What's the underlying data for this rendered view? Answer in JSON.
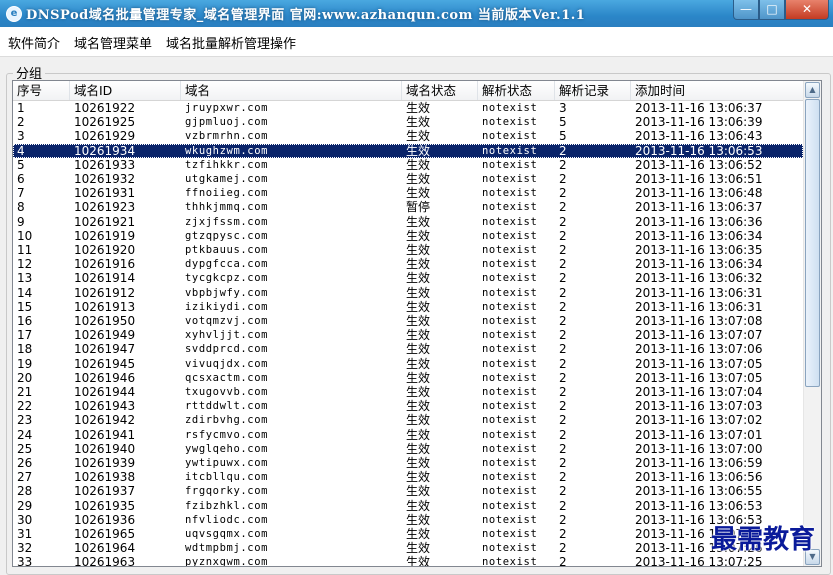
{
  "window": {
    "title": "DNSPod域名批量管理专家_域名管理界面 官网:www.azhanqun.com 当前版本Ver.1.1",
    "minimize": "—",
    "maximize": "□",
    "close": "✕"
  },
  "menu": [
    "软件简介",
    "域名管理菜单",
    "域名批量解析管理操作"
  ],
  "group_label": "分组",
  "columns": [
    "序号",
    "域名ID",
    "域名",
    "域名状态",
    "解析状态",
    "解析记录",
    "添加时间"
  ],
  "selected_row": 4,
  "rows": [
    [
      "1",
      "10261922",
      "jruypxwr.com",
      "生效",
      "notexist",
      "3",
      "2013-11-16 13:06:37"
    ],
    [
      "2",
      "10261925",
      "gjpmluoj.com",
      "生效",
      "notexist",
      "5",
      "2013-11-16 13:06:39"
    ],
    [
      "3",
      "10261929",
      "vzbrmrhn.com",
      "生效",
      "notexist",
      "5",
      "2013-11-16 13:06:43"
    ],
    [
      "4",
      "10261934",
      "wkughzwm.com",
      "生效",
      "notexist",
      "2",
      "2013-11-16 13:06:53"
    ],
    [
      "5",
      "10261933",
      "tzfihkkr.com",
      "生效",
      "notexist",
      "2",
      "2013-11-16 13:06:52"
    ],
    [
      "6",
      "10261932",
      "utgkamej.com",
      "生效",
      "notexist",
      "2",
      "2013-11-16 13:06:51"
    ],
    [
      "7",
      "10261931",
      "ffnoiieg.com",
      "生效",
      "notexist",
      "2",
      "2013-11-16 13:06:48"
    ],
    [
      "8",
      "10261923",
      "thhkjmmq.com",
      "暂停",
      "notexist",
      "2",
      "2013-11-16 13:06:37"
    ],
    [
      "9",
      "10261921",
      "zjxjfssm.com",
      "生效",
      "notexist",
      "2",
      "2013-11-16 13:06:36"
    ],
    [
      "10",
      "10261919",
      "gtzqpysc.com",
      "生效",
      "notexist",
      "2",
      "2013-11-16 13:06:34"
    ],
    [
      "11",
      "10261920",
      "ptkbauus.com",
      "生效",
      "notexist",
      "2",
      "2013-11-16 13:06:35"
    ],
    [
      "12",
      "10261916",
      "dypgfcca.com",
      "生效",
      "notexist",
      "2",
      "2013-11-16 13:06:34"
    ],
    [
      "13",
      "10261914",
      "tycgkcpz.com",
      "生效",
      "notexist",
      "2",
      "2013-11-16 13:06:32"
    ],
    [
      "14",
      "10261912",
      "vbpbjwfy.com",
      "生效",
      "notexist",
      "2",
      "2013-11-16 13:06:31"
    ],
    [
      "15",
      "10261913",
      "izikiydi.com",
      "生效",
      "notexist",
      "2",
      "2013-11-16 13:06:31"
    ],
    [
      "16",
      "10261950",
      "votqmzvj.com",
      "生效",
      "notexist",
      "2",
      "2013-11-16 13:07:08"
    ],
    [
      "17",
      "10261949",
      "xyhvljjt.com",
      "生效",
      "notexist",
      "2",
      "2013-11-16 13:07:07"
    ],
    [
      "18",
      "10261947",
      "svddprcd.com",
      "生效",
      "notexist",
      "2",
      "2013-11-16 13:07:06"
    ],
    [
      "19",
      "10261945",
      "vivuqjdx.com",
      "生效",
      "notexist",
      "2",
      "2013-11-16 13:07:05"
    ],
    [
      "20",
      "10261946",
      "qcsxactm.com",
      "生效",
      "notexist",
      "2",
      "2013-11-16 13:07:05"
    ],
    [
      "21",
      "10261944",
      "txugovvb.com",
      "生效",
      "notexist",
      "2",
      "2013-11-16 13:07:04"
    ],
    [
      "22",
      "10261943",
      "rttddwlt.com",
      "生效",
      "notexist",
      "2",
      "2013-11-16 13:07:03"
    ],
    [
      "23",
      "10261942",
      "zdirbvhg.com",
      "生效",
      "notexist",
      "2",
      "2013-11-16 13:07:02"
    ],
    [
      "24",
      "10261941",
      "rsfycmvo.com",
      "生效",
      "notexist",
      "2",
      "2013-11-16 13:07:01"
    ],
    [
      "25",
      "10261940",
      "ywglqeho.com",
      "生效",
      "notexist",
      "2",
      "2013-11-16 13:07:00"
    ],
    [
      "26",
      "10261939",
      "ywtipuwx.com",
      "生效",
      "notexist",
      "2",
      "2013-11-16 13:06:59"
    ],
    [
      "27",
      "10261938",
      "itcbllqu.com",
      "生效",
      "notexist",
      "2",
      "2013-11-16 13:06:56"
    ],
    [
      "28",
      "10261937",
      "frgqorky.com",
      "生效",
      "notexist",
      "2",
      "2013-11-16 13:06:55"
    ],
    [
      "29",
      "10261935",
      "fzibzhkl.com",
      "生效",
      "notexist",
      "2",
      "2013-11-16 13:06:53"
    ],
    [
      "30",
      "10261936",
      "nfvliodc.com",
      "生效",
      "notexist",
      "2",
      "2013-11-16 13:06:53"
    ],
    [
      "31",
      "10261965",
      "uqvsgqmx.com",
      "生效",
      "notexist",
      "2",
      "2013-11-16 13:07:27"
    ],
    [
      "32",
      "10261964",
      "wdtmpbmj.com",
      "生效",
      "notexist",
      "2",
      "2013-11-16 13:07:26"
    ],
    [
      "33",
      "10261963",
      "pyznxgwm.com",
      "生效",
      "notexist",
      "2",
      "2013-11-16 13:07:25"
    ]
  ],
  "scrollbar": {
    "up": "▲",
    "down": "▼"
  },
  "watermark": "最需教育"
}
